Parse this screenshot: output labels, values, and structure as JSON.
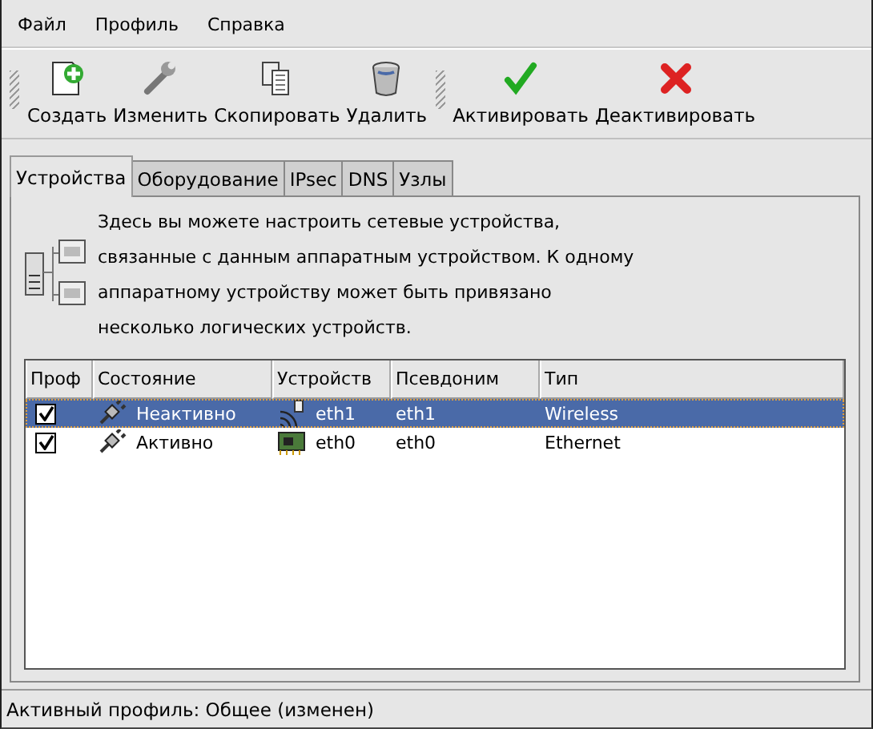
{
  "menu": [
    {
      "label": "Файл"
    },
    {
      "label": "Профиль"
    },
    {
      "label": "Справка"
    }
  ],
  "toolbar": {
    "groups": [
      {
        "items": [
          {
            "label": "Создать",
            "kind": "new"
          },
          {
            "label": "Изменить",
            "kind": "edit"
          },
          {
            "label": "Скопировать",
            "kind": "copy"
          },
          {
            "label": "Удалить",
            "kind": "delete"
          }
        ]
      },
      {
        "items": [
          {
            "label": "Активировать",
            "kind": "activate"
          },
          {
            "label": "Деактивировать",
            "kind": "deactivate"
          }
        ]
      }
    ]
  },
  "tabs": [
    {
      "label": "Устройства",
      "selected": true
    },
    {
      "label": "Оборудование",
      "selected": false
    },
    {
      "label": "IPsec",
      "selected": false
    },
    {
      "label": "DNS",
      "selected": false
    },
    {
      "label": "Узлы",
      "selected": false
    }
  ],
  "description": "Здесь вы можете настроить сетевые устройства, связанные с данным аппаратным устройством. К одному аппаратному устройству может быть привязано несколько логических устройств.",
  "table": {
    "columns": [
      "Проф",
      "Состояние",
      "Устройств",
      "Псевдоним",
      "Тип"
    ],
    "rows": [
      {
        "profile": true,
        "status": "Неактивно",
        "device": "eth1",
        "kind": "wireless",
        "alias": "eth1",
        "type": "Wireless",
        "selected": true
      },
      {
        "profile": true,
        "status": "Активно",
        "device": "eth0",
        "kind": "ethernet",
        "alias": "eth0",
        "type": "Ethernet",
        "selected": false
      }
    ]
  },
  "status_bar": "Активный профиль: Общее (изменен)"
}
